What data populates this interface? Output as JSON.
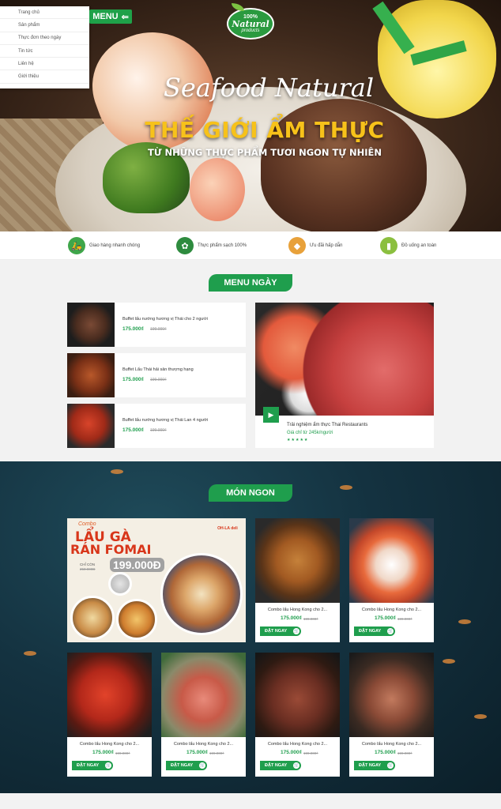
{
  "nav": {
    "menu_label": "MENU",
    "items": [
      "Trang chủ",
      "Sản phẩm",
      "Thực đơn theo ngày",
      "Tin tức",
      "Liên hệ",
      "Giới thiệu"
    ]
  },
  "logo": {
    "top": "100%",
    "main": "Natural",
    "sub": "products"
  },
  "hero": {
    "script": "Seafood Natural",
    "title": "THẾ GIỚI ẨM THỰC",
    "subtitle": "TỪ NHỮNG THỰC PHẨM TƯƠI NGON TỰ  NHIÊN"
  },
  "features": [
    {
      "label": "Giao hàng nhanh chóng",
      "icon": "delivery-scooter-icon",
      "color": "#3fa64a"
    },
    {
      "label": "Thực phẩm sạch 100%",
      "icon": "organic-badge-icon",
      "color": "#2e8b3e"
    },
    {
      "label": "Ưu đãi hấp dẫn",
      "icon": "basket-icon",
      "color": "#e8a13a"
    },
    {
      "label": "Đồ uống an toàn",
      "icon": "drink-icon",
      "color": "#8bbf3f"
    }
  ],
  "menu_today": {
    "heading": "MENU NGÀY",
    "items": [
      {
        "name": "Buffet lẩu nướng hương vị Thái cho 2 người",
        "price": "175.000₫",
        "old_price": "199.000₫"
      },
      {
        "name": "Buffet Lẩu Thái hải sản thượng hạng",
        "price": "175.000₫",
        "old_price": "199.000₫"
      },
      {
        "name": "Buffet lẩu nướng hương vị Thái Lan 4 người",
        "price": "175.000₫",
        "old_price": "199.000₫"
      }
    ],
    "featured": {
      "name": "Trải nghiệm ẩm thực Thai Restaurants",
      "price_text": "Giá chỉ từ 245k/người",
      "rating": 5,
      "stars": "★★★★★"
    }
  },
  "mon_ngon": {
    "heading": "MÓN NGON",
    "combo": {
      "small": "Combo",
      "title1": "LẨU GÀ",
      "title2": "RÁN FOMAI",
      "chi_con": "CHỈ CÒN",
      "old": "250.000Đ",
      "price": "199.000Đ",
      "brand": "OH-LA deli"
    },
    "cards": [
      {
        "name": "Combo lẩu Hong Kong cho 2...",
        "price": "175.000₫",
        "old_price": "199.000₫",
        "order": "ĐẶT NGAY"
      },
      {
        "name": "Combo lẩu Hong Kong cho 2...",
        "price": "175.000₫",
        "old_price": "199.000₫",
        "order": "ĐẶT NGAY"
      },
      {
        "name": "Combo lẩu Hong Kong cho 2...",
        "price": "175.000₫",
        "old_price": "199.000₫",
        "order": "ĐẶT NGAY"
      },
      {
        "name": "Combo lẩu Hong Kong cho 2...",
        "price": "175.000₫",
        "old_price": "199.000₫",
        "order": "ĐẶT NGAY"
      },
      {
        "name": "Combo lẩu Hong Kong cho 2...",
        "price": "175.000₫",
        "old_price": "199.000₫",
        "order": "ĐẶT NGAY"
      },
      {
        "name": "Combo lẩu Hong Kong cho 2...",
        "price": "175.000₫",
        "old_price": "199.000₫",
        "order": "ĐẶT NGAY"
      }
    ]
  },
  "colors": {
    "accent": "#1f9e4d",
    "title_yellow": "#f7c21a",
    "combo_red": "#d8361a"
  }
}
